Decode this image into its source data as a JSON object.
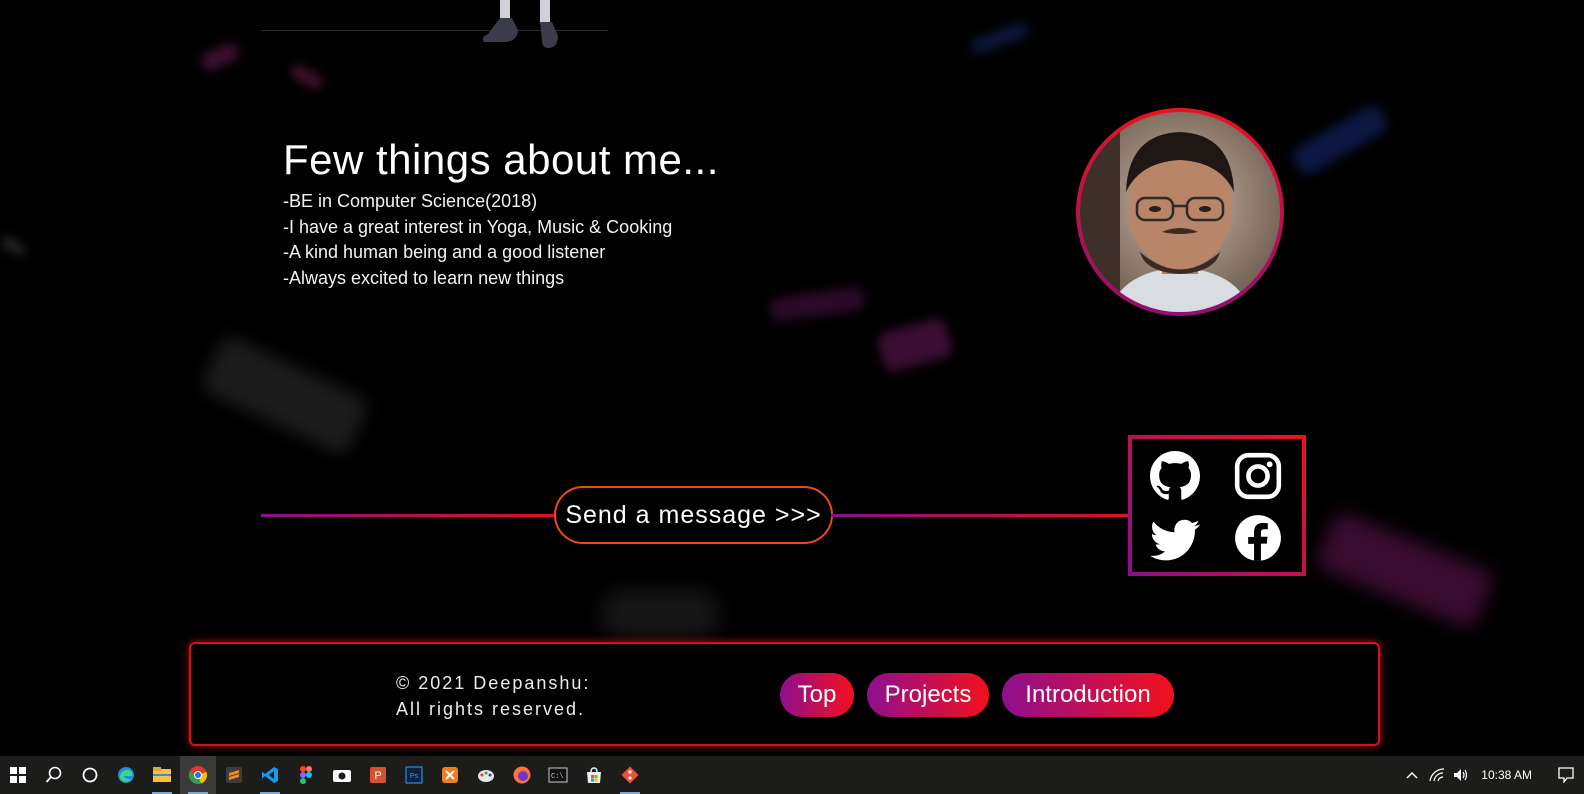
{
  "about": {
    "title": "Few things about me...",
    "items": [
      "-BE in Computer Science(2018)",
      "-I have a great interest in Yoga, Music & Cooking",
      "-A kind human being and a good listener",
      "-Always excited to learn new things"
    ]
  },
  "contact": {
    "send_label": "Send a message >>>",
    "social_icons": [
      "github-icon",
      "instagram-icon",
      "twitter-icon",
      "facebook-icon"
    ]
  },
  "footer": {
    "copyright_line1": "© 2021 Deepanshu:",
    "copyright_line2": "All rights reserved.",
    "nav": {
      "top": "Top",
      "projects": "Projects",
      "introduction": "Introduction"
    }
  },
  "taskbar": {
    "time": "10:38 AM",
    "apps": [
      "start-icon",
      "search-icon",
      "cortana-icon",
      "edge-icon",
      "file-explorer-icon",
      "chrome-icon",
      "sublime-icon",
      "vscode-icon",
      "figma-icon",
      "camera-icon",
      "powerpoint-icon",
      "photoshop-icon",
      "xampp-icon",
      "paint-icon",
      "firefox-icon",
      "terminal-icon",
      "store-icon",
      "git-icon"
    ]
  },
  "colors": {
    "accent_red": "#f0101c",
    "accent_purple": "#8d0f8c",
    "button_orange": "#f0471e",
    "background": "#000000"
  }
}
